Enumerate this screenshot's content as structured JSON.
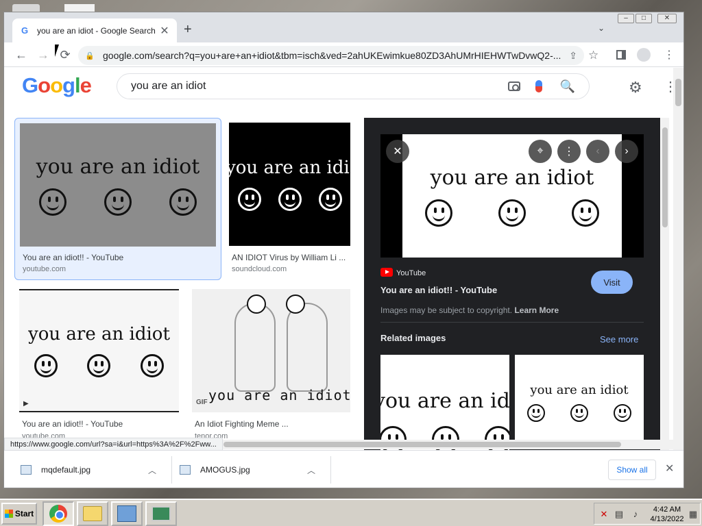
{
  "tab": {
    "title": "you are an idiot - Google Search",
    "favicon": "G",
    "close": "✕",
    "new_tab": "+",
    "search_tabs": "⌄"
  },
  "window_controls": {
    "minimize": "‒",
    "maximize": "□",
    "close": "✕"
  },
  "toolbar": {
    "back": "←",
    "forward": "→",
    "reload": "⟳",
    "url": "google.com/search?q=you+are+an+idiot&tbm=isch&ved=2ahUKEwimkue80ZD3AhUMrHIEHWTwDvwQ2-...",
    "lock": "🔒",
    "share": "⇪",
    "star": "☆",
    "menu": "⋮"
  },
  "google": {
    "logo": [
      "G",
      "o",
      "o",
      "g",
      "l",
      "e"
    ],
    "logo_colors": [
      "#4285f4",
      "#ea4335",
      "#fbbc05",
      "#4285f4",
      "#34a853",
      "#ea4335"
    ],
    "query": "you are an idiot",
    "search_icon": "🔍",
    "settings_icon": "⚙",
    "apps_icon": "⋮⋮"
  },
  "results": [
    {
      "thumb_text": "you are an idiot",
      "title": "You are an idiot!! - YouTube",
      "source": "youtube.com"
    },
    {
      "thumb_text": "you are an idiot",
      "title": "AN IDIOT Virus by William Li ...",
      "source": "soundcloud.com"
    },
    {
      "thumb_text": "you are an idiot",
      "title": "You are an idiot!! - YouTube",
      "source": "youtube.com",
      "badge": "▶"
    },
    {
      "thumb_text": "you are an idiot!",
      "title": "An Idiot Fighting Meme ...",
      "source": "tenor.com",
      "badge": "GIF"
    }
  ],
  "preview": {
    "image_text": "you are an idiot",
    "close": "✕",
    "more": "⋮",
    "prev": "‹",
    "next": "›",
    "source": "YouTube",
    "title": "You are an idiot!! - YouTube",
    "visit": "Visit",
    "copyright": "Images may be subject to copyright.",
    "learn_more": "Learn More",
    "related_title": "Related images",
    "see_more": "See more",
    "related": [
      {
        "text": "you are an idio"
      },
      {
        "text": "you are an idiot"
      }
    ]
  },
  "status_url": "https://www.google.com/url?sa=i&url=https%3A%2F%2Fww...",
  "downloads": {
    "items": [
      {
        "name": "mqdefault.jpg"
      },
      {
        "name": "AMOGUS.jpg"
      }
    ],
    "chevron": "︿",
    "show_all": "Show all",
    "close": "✕"
  },
  "taskbar": {
    "start": "Start",
    "time": "4:42 AM",
    "date": "4/13/2022"
  }
}
